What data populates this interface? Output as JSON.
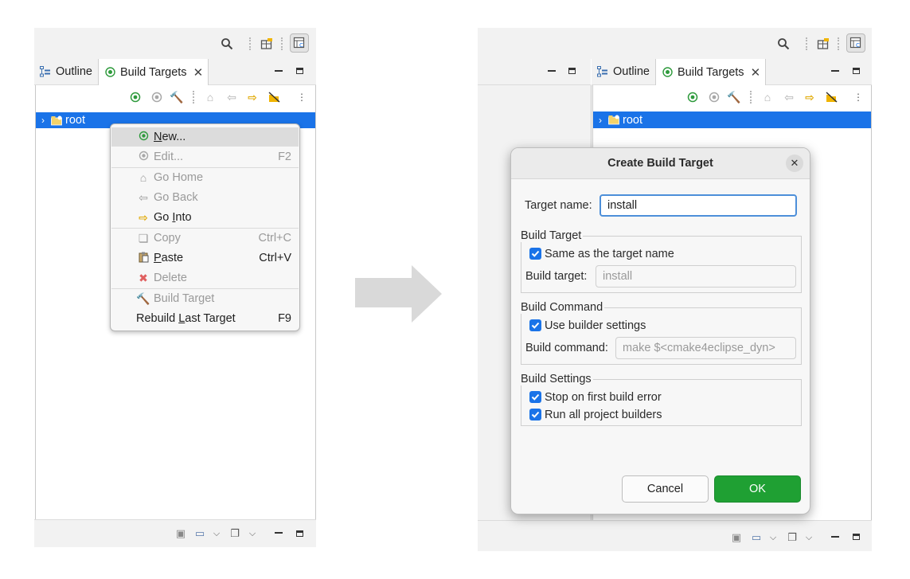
{
  "left_panel": {
    "tabs": [
      {
        "label": "Outline"
      },
      {
        "label": "Build Targets"
      }
    ],
    "tree_root": "root",
    "context_menu": {
      "items": [
        {
          "pre": "",
          "mn": "N",
          "post": "ew...",
          "shortcut": "",
          "enabled": true
        },
        {
          "pre": "",
          "mn": "",
          "post": "Edit...",
          "shortcut": "F2",
          "enabled": false
        },
        {
          "pre": "",
          "mn": "",
          "post": "Go Home",
          "shortcut": "",
          "enabled": false
        },
        {
          "pre": "",
          "mn": "",
          "post": "Go Back",
          "shortcut": "",
          "enabled": false
        },
        {
          "pre": "Go ",
          "mn": "I",
          "post": "nto",
          "shortcut": "",
          "enabled": true
        },
        {
          "pre": "",
          "mn": "",
          "post": "Copy",
          "shortcut": "Ctrl+C",
          "enabled": false
        },
        {
          "pre": "",
          "mn": "P",
          "post": "aste",
          "shortcut": "Ctrl+V",
          "enabled": true
        },
        {
          "pre": "",
          "mn": "",
          "post": "Delete",
          "shortcut": "",
          "enabled": false
        },
        {
          "pre": "",
          "mn": "",
          "post": "Build Target",
          "shortcut": "",
          "enabled": false
        },
        {
          "pre": "Rebuild ",
          "mn": "L",
          "post": "ast Target",
          "shortcut": "F9",
          "enabled": true
        }
      ]
    }
  },
  "right_panel": {
    "tabs": [
      {
        "label": "Outline"
      },
      {
        "label": "Build Targets"
      }
    ],
    "tree_root": "root"
  },
  "dialog": {
    "title": "Create Build Target",
    "target_name_label": "Target name:",
    "target_name_value": "install",
    "group_build_target": {
      "title": "Build Target",
      "same_as_name": "Same as the target name",
      "build_target_label": "Build target:",
      "build_target_value": "install"
    },
    "group_build_command": {
      "title": "Build Command",
      "use_builder": "Use builder settings",
      "build_command_label": "Build command:",
      "build_command_value": "make $<cmake4eclipse_dyn>"
    },
    "group_build_settings": {
      "title": "Build Settings",
      "stop_on_error": "Stop on first build error",
      "run_all": "Run all project builders"
    },
    "cancel_label": "Cancel",
    "ok_label": "OK"
  },
  "colors": {
    "selection": "#1a73e8",
    "ok_button": "#1fa033",
    "focus_border": "#4d8fd9",
    "arrow": "#d9d9d9"
  },
  "icons": [
    "search-icon",
    "open-perspective-icon",
    "cmake-perspective-icon",
    "outline-icon",
    "build-target-icon",
    "close-icon",
    "minimize-icon",
    "maximize-icon",
    "new-target-icon",
    "edit-target-icon",
    "build-icon",
    "home-icon",
    "back-icon",
    "forward-icon",
    "hide-icon",
    "view-menu-icon",
    "project-folder-icon",
    "copy-icon",
    "paste-icon",
    "delete-icon",
    "check-icon",
    "arrow-icon"
  ]
}
